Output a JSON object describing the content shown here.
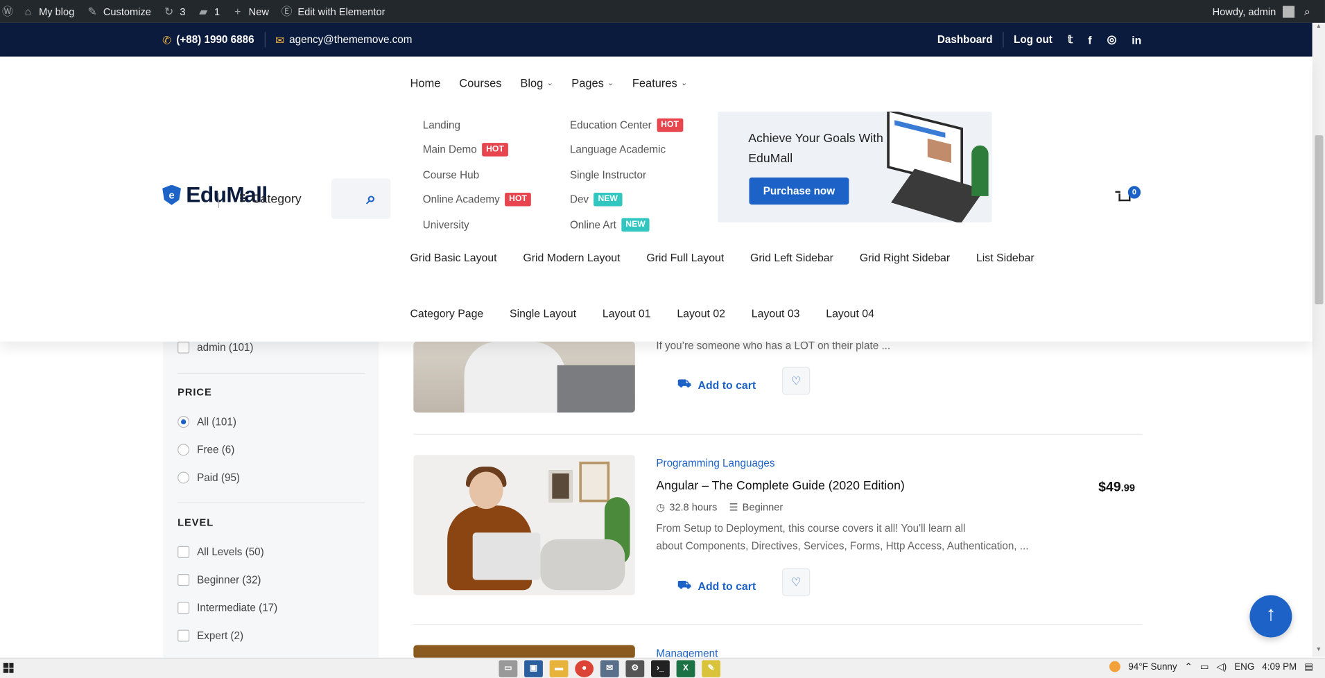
{
  "adminbar": {
    "wp_icon": "wordpress-icon",
    "items": [
      {
        "icon": "home-icon",
        "label": "My blog"
      },
      {
        "icon": "brush-icon",
        "label": "Customize"
      },
      {
        "icon": "updates-icon",
        "label": "3"
      },
      {
        "icon": "comment-icon",
        "label": "1"
      },
      {
        "icon": "plus-icon",
        "label": "New"
      },
      {
        "icon": "elementor-icon",
        "label": "Edit with Elementor"
      }
    ],
    "howdy": "Howdy, admin"
  },
  "topbar": {
    "phone": "(+88) 1990 6886",
    "email": "agency@thememove.com",
    "dashboard": "Dashboard",
    "logout": "Log out",
    "social": [
      "twitter-icon",
      "facebook-icon",
      "instagram-icon",
      "linkedin-icon"
    ]
  },
  "header": {
    "logo": "EduMall",
    "category": "Category",
    "nav": [
      "Home",
      "Courses",
      "Blog",
      "Pages",
      "Features"
    ],
    "mega_col1": [
      {
        "label": "Landing",
        "badge": ""
      },
      {
        "label": "Main Demo",
        "badge": "HOT"
      },
      {
        "label": "Course Hub",
        "badge": ""
      },
      {
        "label": "Online Academy",
        "badge": "HOT"
      },
      {
        "label": "University",
        "badge": ""
      }
    ],
    "mega_col2": [
      {
        "label": "Education Center",
        "badge": "HOT"
      },
      {
        "label": "Language Academic",
        "badge": ""
      },
      {
        "label": "Single Instructor",
        "badge": ""
      },
      {
        "label": "Dev",
        "badge": "NEW"
      },
      {
        "label": "Online Art",
        "badge": "NEW"
      }
    ],
    "promo_title": "Achieve Your Goals With EduMall",
    "promo_button": "Purchase now",
    "cart_count": "0",
    "grid_links": [
      "Grid Basic Layout",
      "Grid Modern Layout",
      "Grid Full Layout",
      "Grid Left Sidebar",
      "Grid Right Sidebar",
      "List Sidebar"
    ],
    "layout_links": [
      "Category Page",
      "Single Layout",
      "Layout 01",
      "Layout 02",
      "Layout 03",
      "Layout 04"
    ]
  },
  "sidebar": {
    "author_item": "admin (101)",
    "price_title": "PRICE",
    "price_options": [
      "All (101)",
      "Free (6)",
      "Paid (95)"
    ],
    "level_title": "LEVEL",
    "level_options": [
      "All Levels (50)",
      "Beginner (32)",
      "Intermediate (17)",
      "Expert (2)"
    ]
  },
  "courses": [
    {
      "desc": "If you’re someone who has a LOT on their plate ...",
      "add_to_cart": "Add to cart"
    },
    {
      "category": "Programming Languages",
      "title": "Angular – The Complete Guide (2020 Edition)",
      "hours": "32.8 hours",
      "level": "Beginner",
      "desc_line1": "From Setup to Deployment, this course covers it all! You'll learn all",
      "desc_line2": "about Components, Directives, Services, Forms, Http Access, Authentication, ...",
      "price_main": "$49",
      "price_cents": ".99",
      "add_to_cart": "Add to cart"
    },
    {
      "category": "Management"
    }
  ],
  "taskbar": {
    "weather": "94°F  Sunny",
    "lang": "ENG",
    "time": "4:09 PM"
  }
}
